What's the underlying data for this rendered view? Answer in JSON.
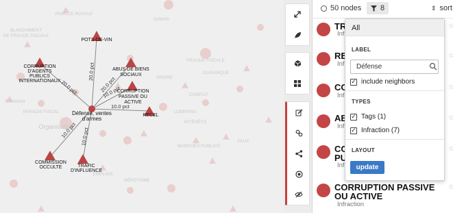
{
  "graph": {
    "center_node": {
      "label_line1": "Défense, ventes",
      "label_line2": "d'armes"
    },
    "nodes": [
      {
        "name": "pots-de-vin",
        "lines": [
          "POTS-DE-VIN"
        ]
      },
      {
        "name": "corruption-agents",
        "lines": [
          "CORRUPTION",
          "D'AGENTS",
          "PUBLICS",
          "INTERNATIONAUX"
        ]
      },
      {
        "name": "abus-de-biens",
        "lines": [
          "ABUS DE BIENS",
          "SOCIAUX"
        ]
      },
      {
        "name": "corruption-passive",
        "lines": [
          "CORRUPTION",
          "PASSIVE OU",
          "ACTIVE"
        ]
      },
      {
        "name": "recel",
        "lines": [
          "RECEL"
        ]
      },
      {
        "name": "commission-occulte",
        "lines": [
          "COMMISSION",
          "OCCULTE"
        ]
      },
      {
        "name": "trafic-influence",
        "lines": [
          "TRAFIC",
          "D'INFLUENCE"
        ]
      }
    ],
    "edge_labels": [
      "20.0 pct",
      "20.0 pct",
      "20.0 pct",
      "10.0 pct",
      "10.0 pct",
      "10.0 pct",
      "10.0 pct"
    ],
    "ghost_labels": [
      "FAMILLE ROYALE",
      "SAMAR",
      "BLANCHIMENT",
      "DE FRAUDE FISCALE",
      "FRAUDE FISCALE",
      "MARCHÉS PUBLICS",
      "LOBBYING",
      "ÉVASION",
      "NÉPOTISME",
      "CONFLIT",
      "OLIGARQUE",
      "ORDRE",
      "PARADIS FISCAL",
      "FAUX",
      "INTÉRÊTS",
      "EMPLOIS",
      "Organisation"
    ]
  },
  "toolbar": {
    "icons": [
      "expand-icon",
      "leaf-icon",
      "cube-icon",
      "grid-icon",
      "edit-icon",
      "link-icon",
      "share-icon",
      "target-icon",
      "eye-slash-icon"
    ]
  },
  "topbar": {
    "nodes_count": "50 nodes",
    "filter_count": "8",
    "sort_label": "sort"
  },
  "list": {
    "items": [
      {
        "title": "TR",
        "sub": "Infra"
      },
      {
        "title": "RE",
        "sub": "Infra"
      },
      {
        "title": "CO",
        "sub": "Infra"
      },
      {
        "title": "AB",
        "sub": "Infra"
      },
      {
        "title": "CO\nPU",
        "sub": "Infr"
      },
      {
        "title": "CORRUPTION PASSIVE OU ACTIVE",
        "sub": "Infraction"
      }
    ]
  },
  "dropdown": {
    "all_label": "All",
    "label_heading": "LABEL",
    "label_value": "Défense",
    "include_neighbors": "include neighbors",
    "types_heading": "TYPES",
    "types": [
      {
        "label": "Tags (1)",
        "checked": true
      },
      {
        "label": "Infraction (7)",
        "checked": true
      }
    ],
    "layout_heading": "LAYOUT",
    "update_label": "update"
  },
  "colors": {
    "node_red": "#b94545",
    "ghost_red": "#e6bcbc",
    "update_blue": "#3a79c6",
    "accent_red": "#c83e3e"
  }
}
